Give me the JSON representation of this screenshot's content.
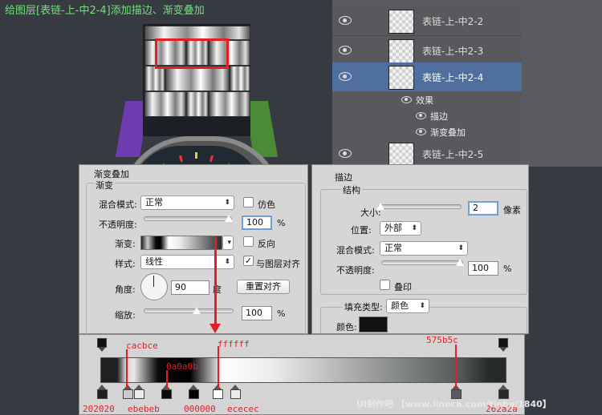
{
  "title": "给图层[表链-上-中2-4]添加描边、渐变叠加",
  "layers": [
    {
      "name": "表链-上-中2-2",
      "selected": false
    },
    {
      "name": "表链-上-中2-3",
      "selected": false
    },
    {
      "name": "表链-上-中2-4",
      "selected": true
    },
    {
      "name": "表链-上-中2-5",
      "selected": false
    }
  ],
  "effects": {
    "label": "效果",
    "items": [
      "描边",
      "渐变叠加"
    ]
  },
  "gradient_overlay": {
    "title": "渐变叠加",
    "group": "渐变",
    "blend_mode_label": "混合模式:",
    "blend_mode": "正常",
    "dither_label": "仿色",
    "opacity_label": "不透明度:",
    "opacity": "100",
    "percent": "%",
    "gradient_label": "渐变:",
    "reverse_label": "反向",
    "style_label": "样式:",
    "style": "线性",
    "align_label": "与图层对齐",
    "angle_label": "角度:",
    "angle": "90",
    "degree": "度",
    "reset_button": "重置对齐",
    "scale_label": "缩放:",
    "scale": "100"
  },
  "stroke": {
    "title": "描边",
    "group": "结构",
    "size_label": "大小:",
    "size": "2",
    "size_unit": "像素",
    "position_label": "位置:",
    "position": "外部",
    "blend_mode_label": "混合模式:",
    "blend_mode": "正常",
    "opacity_label": "不透明度:",
    "opacity": "100",
    "percent": "%",
    "overprint_label": "叠印",
    "fill_type_label": "填充类型:",
    "fill_type": "颜色",
    "color_label": "颜色:",
    "color": "#111111"
  },
  "gradient_stops": [
    {
      "label": "202020",
      "color": "#202020"
    },
    {
      "label": "cacbce",
      "color": "#cacbce"
    },
    {
      "label": "ebebeb",
      "color": "#ebebeb"
    },
    {
      "label": "0a0a0b",
      "color": "#0a0a0b"
    },
    {
      "label": "000000",
      "color": "#000000"
    },
    {
      "label": "ffffff",
      "color": "#ffffff"
    },
    {
      "label": "ececec",
      "color": "#ececec"
    },
    {
      "label": "575b5c",
      "color": "#575b5c"
    },
    {
      "label": "262a2a",
      "color": "#262a2a"
    }
  ],
  "watermark": "UI制作吧 【www.lineca.com/tieba/1840】",
  "colors": {
    "accent_red": "#e31e24",
    "title_green": "#6fe07a",
    "layer_selected": "#4f6f9e"
  }
}
